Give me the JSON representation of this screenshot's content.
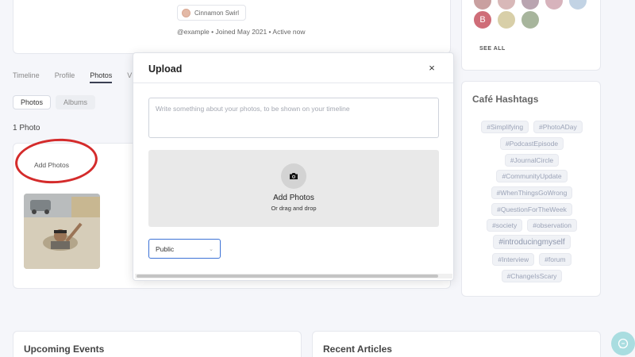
{
  "profile": {
    "badge_label": "Cinnamon Swirl",
    "meta": "@example • Joined May 2021 • Active now"
  },
  "tabs": [
    {
      "label": "Timeline"
    },
    {
      "label": "Profile"
    },
    {
      "label": "Photos"
    },
    {
      "label": "V"
    }
  ],
  "subtabs": [
    {
      "label": "Photos"
    },
    {
      "label": "Albums"
    }
  ],
  "photos": {
    "count_label": "1 Photo",
    "add_label": "Add Photos"
  },
  "members": {
    "avatar_initial": "B",
    "see_all": "SEE ALL",
    "colors": [
      "#c9a0a0",
      "#d8b8b8",
      "#b9a4b0",
      "#d7b3bc",
      "#c2d3e4",
      "#cf6d78",
      "#d8cfa8",
      "#a7b59c"
    ]
  },
  "hashtags": {
    "title": "Café Hashtags",
    "lines": [
      [
        "#Simplifying",
        "#PhotoADay"
      ],
      [
        "#PodcastEpisode"
      ],
      [
        "#JournalCircle"
      ],
      [
        "#CommunityUpdate"
      ],
      [
        "#WhenThingsGoWrong"
      ],
      [
        "#QuestionForTheWeek"
      ],
      [
        "#society",
        "#observation"
      ],
      [
        "#introducingmyself"
      ],
      [
        "#Interview",
        "#forum"
      ],
      [
        "#ChangeIsScary"
      ]
    ]
  },
  "bottom": {
    "events_title": "Upcoming Events",
    "articles_title": "Recent Articles"
  },
  "modal": {
    "title": "Upload",
    "close": "×",
    "caption_placeholder": "Write something about your photos, to be shown on your timeline",
    "dropzone_title": "Add Photos",
    "dropzone_sub": "Or drag and drop",
    "privacy_value": "Public"
  },
  "colors": {
    "accent": "#3c72d6",
    "annotation": "#d42b2b",
    "chat": "#a9dde0"
  }
}
